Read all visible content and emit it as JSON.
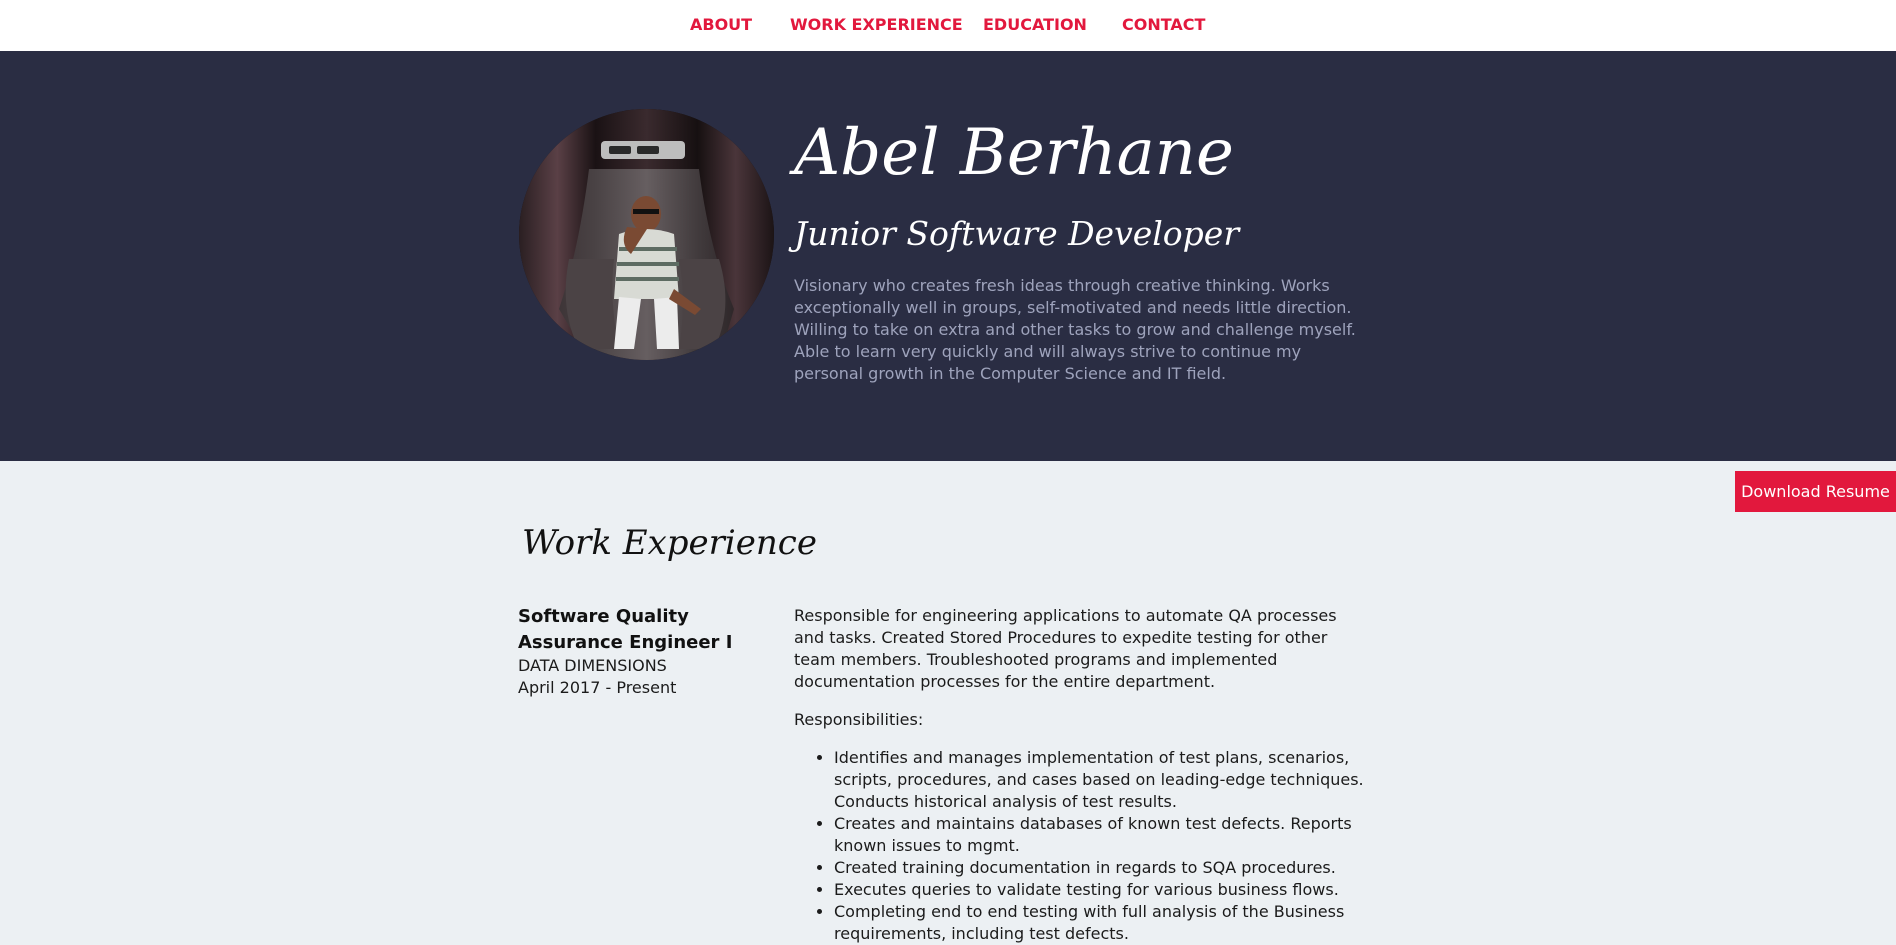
{
  "nav": {
    "items": [
      "ABOUT",
      "WORK EXPERIENCE",
      "EDUCATION",
      "CONTACT"
    ]
  },
  "hero": {
    "name": "Abel Berhane",
    "role": "Junior Software Developer",
    "summary": "Visionary who creates fresh ideas through creative thinking. Works exceptionally well in groups, self-motivated and needs little direction. Willing to take on extra and other tasks to grow and challenge myself. Able to learn very quickly and will always strive to continue my personal growth in the Computer Science and IT field.",
    "download_label": "Download Resume"
  },
  "work": {
    "section_title": "Work Experience",
    "jobs": [
      {
        "title": "Software Quality Assurance Engineer I",
        "company": "DATA DIMENSIONS",
        "dates": "April 2017 - Present",
        "description": "Responsible for engineering applications to automate QA processes and tasks. Created Stored Procedures to expedite testing for other team members. Troubleshooted programs and implemented documentation processes for the entire department.",
        "responsibilities_label": "Responsibilities:",
        "responsibilities": [
          "Identifies and manages implementation of test plans, scenarios, scripts, procedures, and cases based on leading-edge techniques. Conducts historical analysis of test results.",
          "Creates and maintains databases of known test defects. Reports known issues to mgmt.",
          "Created training documentation in regards to SQA procedures.",
          "Executes queries to validate testing for various business flows.",
          "Completing end to end testing with full analysis of the Business requirements, including test defects."
        ]
      }
    ]
  },
  "colors": {
    "accent": "#e2183d",
    "hero_bg": "#2a2d43",
    "page_bg": "#ecf0f3",
    "summary_text": "#9ea3bc"
  }
}
